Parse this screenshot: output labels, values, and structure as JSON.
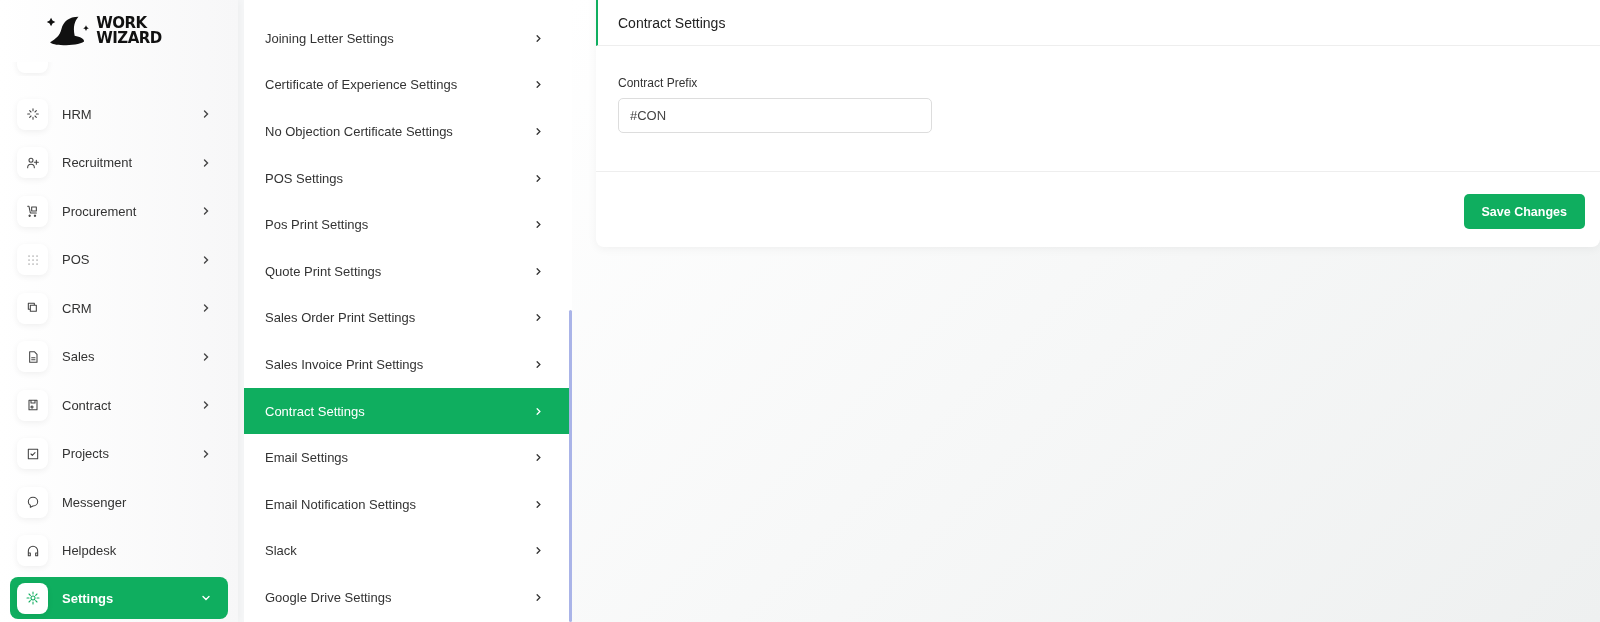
{
  "logo": {
    "line_1": "WORK",
    "line_2": "WIZARD"
  },
  "sidebar": {
    "items": [
      {
        "label": "HRM",
        "kind": "submenu",
        "expanded": false,
        "selected": false
      },
      {
        "label": "Recruitment",
        "kind": "submenu",
        "expanded": false,
        "selected": false
      },
      {
        "label": "Procurement",
        "kind": "submenu",
        "expanded": false,
        "selected": false
      },
      {
        "label": "POS",
        "kind": "submenu",
        "expanded": false,
        "selected": false
      },
      {
        "label": "CRM",
        "kind": "submenu",
        "expanded": false,
        "selected": false
      },
      {
        "label": "Sales",
        "kind": "submenu",
        "expanded": false,
        "selected": false
      },
      {
        "label": "Contract",
        "kind": "submenu",
        "expanded": false,
        "selected": false
      },
      {
        "label": "Projects",
        "kind": "submenu",
        "expanded": false,
        "selected": false
      },
      {
        "label": "Messenger",
        "kind": "link",
        "selected": false
      },
      {
        "label": "Helpdesk",
        "kind": "link",
        "selected": false
      },
      {
        "label": "Settings",
        "kind": "submenu",
        "expanded": true,
        "selected": true
      }
    ]
  },
  "settings_menu": {
    "items": [
      {
        "label": "Joining Letter Settings",
        "selected": false
      },
      {
        "label": "Certificate of Experience Settings",
        "selected": false
      },
      {
        "label": "No Objection Certificate Settings",
        "selected": false
      },
      {
        "label": "POS Settings",
        "selected": false
      },
      {
        "label": "Pos Print Settings",
        "selected": false
      },
      {
        "label": "Quote Print Settings",
        "selected": false
      },
      {
        "label": "Sales Order Print Settings",
        "selected": false
      },
      {
        "label": "Sales Invoice Print Settings",
        "selected": false
      },
      {
        "label": "Contract Settings",
        "selected": true
      },
      {
        "label": "Email Settings",
        "selected": false
      },
      {
        "label": "Email Notification Settings",
        "selected": false
      },
      {
        "label": "Slack",
        "selected": false
      },
      {
        "label": "Google Drive Settings",
        "selected": false
      }
    ]
  },
  "card": {
    "title": "Contract Settings",
    "field": {
      "label": "Contract Prefix",
      "value": "#CON"
    },
    "button": "Save Changes"
  }
}
